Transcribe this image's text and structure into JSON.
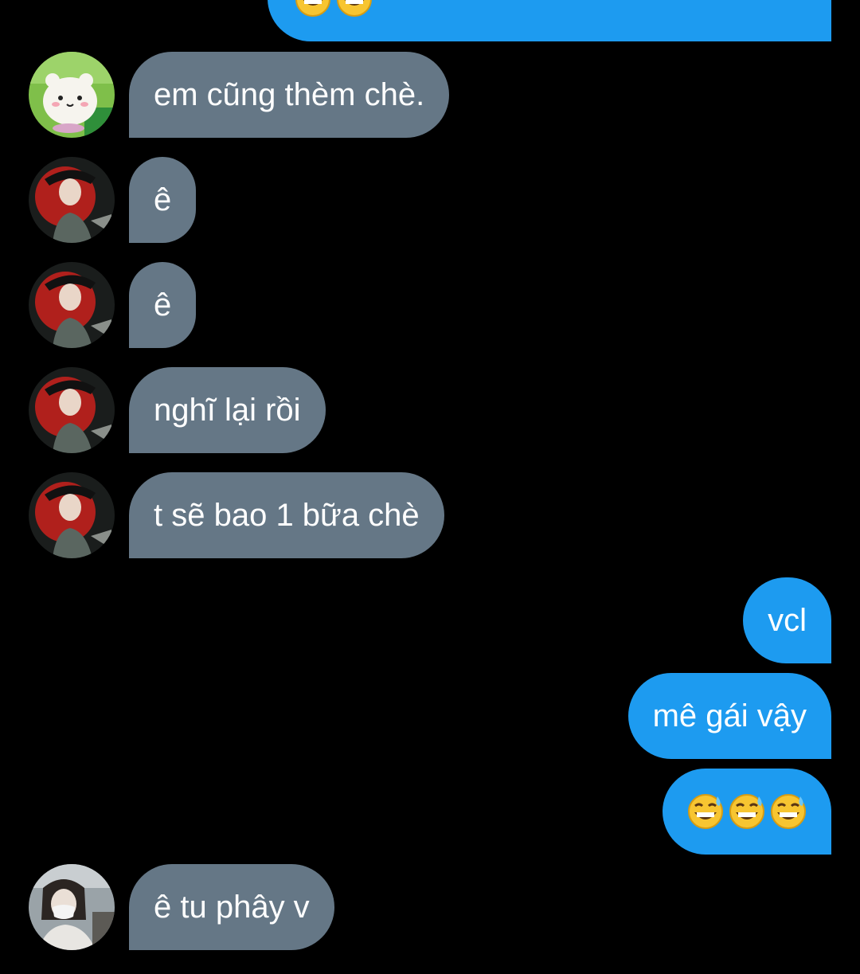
{
  "conversation": {
    "messages": [
      {
        "side": "outgoing",
        "text": "😅😅",
        "partial": true
      },
      {
        "side": "incoming",
        "avatar": "bear-mascot-avatar",
        "text": "em cũng thèm chè."
      },
      {
        "side": "incoming",
        "avatar": "red-hair-girl-avatar",
        "text": "ê"
      },
      {
        "side": "incoming",
        "avatar": "red-hair-girl-avatar",
        "text": "ê"
      },
      {
        "side": "incoming",
        "avatar": "red-hair-girl-avatar",
        "text": "nghĩ lại rồi"
      },
      {
        "side": "incoming",
        "avatar": "red-hair-girl-avatar",
        "text": "t sẽ bao 1 bữa chè"
      },
      {
        "side": "outgoing",
        "text": "vcl"
      },
      {
        "side": "outgoing",
        "text": "mê gái vậy"
      },
      {
        "side": "outgoing",
        "text": "😅😅😅"
      },
      {
        "side": "incoming",
        "avatar": "masked-girl-avatar",
        "text": "ê tu phây v"
      }
    ]
  },
  "colors": {
    "incoming_bubble": "#657786",
    "outgoing_bubble": "#1d9bf0",
    "background": "#000000"
  }
}
